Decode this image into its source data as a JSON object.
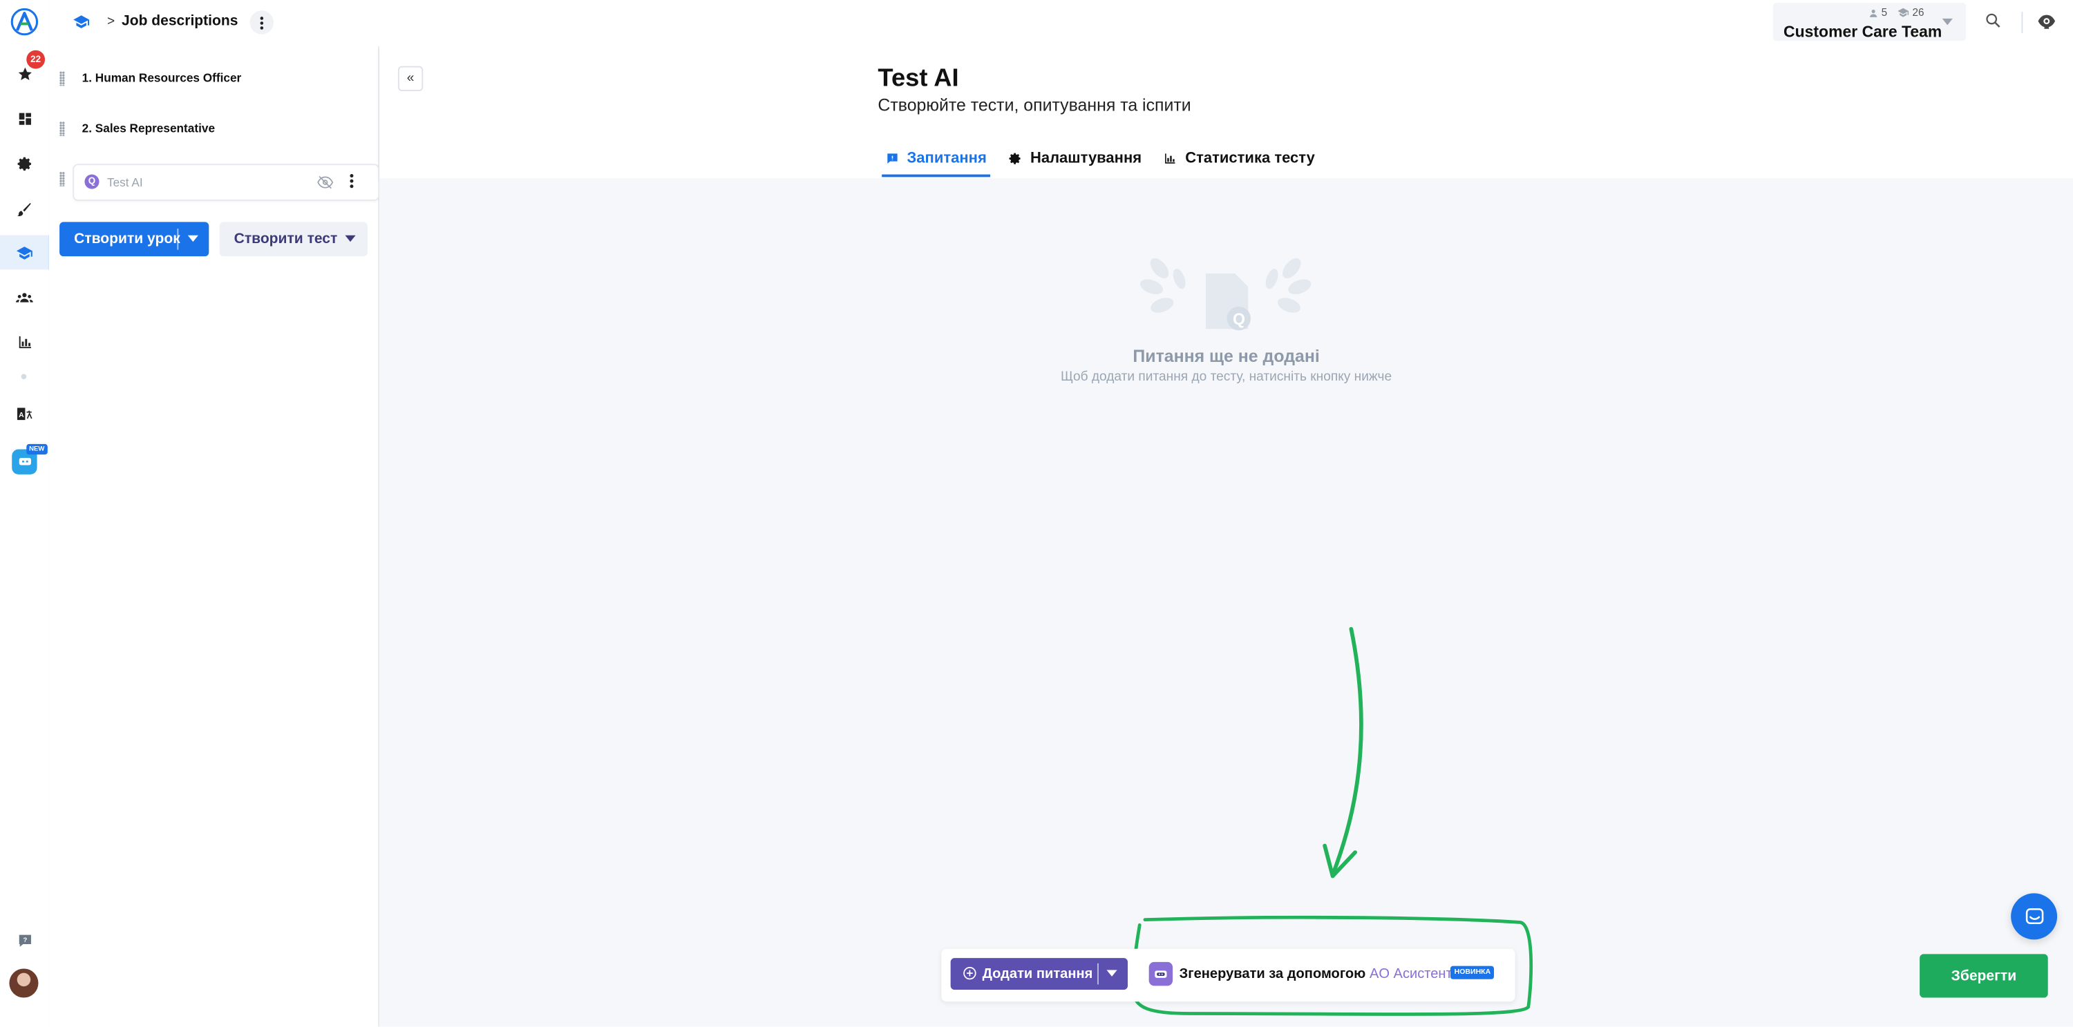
{
  "rail": {
    "notification_count": "22",
    "new_tag": "NEW",
    "icons": [
      "star-icon",
      "dashboard-icon",
      "gear-icon",
      "brush-icon",
      "graduation-cap-icon",
      "team-icon",
      "chart-icon",
      "translate-icon",
      "robot-icon",
      "help-icon"
    ]
  },
  "header": {
    "breadcrumb_separator": ">",
    "breadcrumb_title": "Job descriptions",
    "team": {
      "members": "5",
      "learners": "26",
      "name": "Customer Care Team"
    }
  },
  "sidebar": {
    "lessons": [
      {
        "label": "1. Human Resources Officer"
      },
      {
        "label": "2. Sales Representative"
      }
    ],
    "test_item": {
      "badge": "Q",
      "label": "Test AI"
    },
    "create_lesson_label": "Створити урок",
    "create_test_label": "Створити тест"
  },
  "main": {
    "collapse_label": "«",
    "title": "Test AI",
    "subtitle": "Створюйте тести, опитування та іспити",
    "tabs": [
      {
        "label": "Запитання",
        "active": true
      },
      {
        "label": "Налаштування",
        "active": false
      },
      {
        "label": "Статистика тесту",
        "active": false
      }
    ],
    "empty_title": "Питання ще не додані",
    "empty_subtitle": "Щоб додати питання до тесту, натисніть кнопку нижче"
  },
  "bottom": {
    "add_question_label": "Додати питання",
    "generate_prefix": "Згенерувати за допомогою",
    "generate_ai": "AO Асистента",
    "new_badge": "НОВИНКА",
    "save_label": "Зберегти"
  },
  "colors": {
    "accent": "#1a73e8",
    "purple": "#5b4fb0",
    "save_green": "#1fab5e",
    "annotation_green": "#22b35a"
  }
}
